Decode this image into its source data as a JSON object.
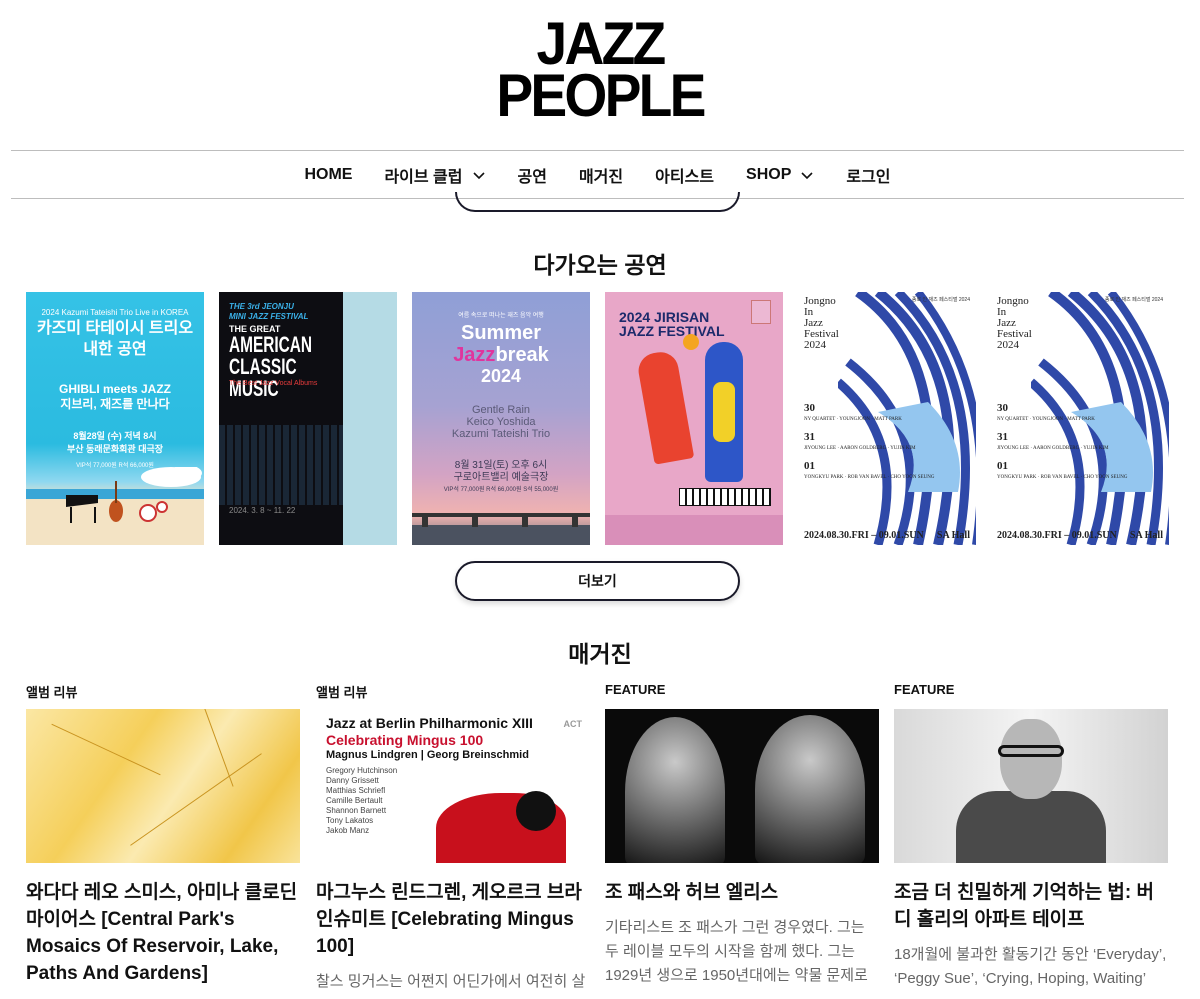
{
  "logo": {
    "line1": "JAZZ",
    "line2": "PEOPLE"
  },
  "nav": {
    "items": [
      {
        "label": "HOME",
        "has_dropdown": false
      },
      {
        "label": "라이브 클럽",
        "has_dropdown": true
      },
      {
        "label": "공연",
        "has_dropdown": false
      },
      {
        "label": "매거진",
        "has_dropdown": false
      },
      {
        "label": "아티스트",
        "has_dropdown": false
      },
      {
        "label": "SHOP",
        "has_dropdown": true
      },
      {
        "label": "로그인",
        "has_dropdown": false
      }
    ]
  },
  "upcoming": {
    "title": "다가오는 공연",
    "more_label": "더보기",
    "posters": [
      {
        "line1": "2024 Kazumi Tateishi Trio Live in KOREA",
        "line2": "카즈미 타테이시 트리오",
        "line3": "내한 공연",
        "line4": "GHIBLI meets JAZZ",
        "line5": "지브리, 재즈를 만나다",
        "line6": "8월28일 (수) 저녁 8시",
        "line7": "부산 동래문화회관 대극장",
        "line8": "VIP석 77,000원 R석 66,000원"
      },
      {
        "line1": "THE 3rd JEONJU",
        "line1b": "MINI JAZZ FESTIVAL",
        "line2": "THE GREAT",
        "line3": "AMERICAN",
        "line3b": "CLASSIC MUSIC",
        "line4": "The Best Jazz Vocal Albums",
        "line5": "2024. 3. 8 ~ 11. 22"
      },
      {
        "line0": "여름 속으로 떠나는 재즈 음악 여행",
        "line1": "Summer",
        "line2a": "Jazz",
        "line2b": "break",
        "line3": "2024",
        "line4": "Gentle Rain",
        "line5": "Keico Yoshida",
        "line6": "Kazumi Tateishi Trio",
        "line7": "8월 31일(토) 오후 6시",
        "line8": "구로아트밸리 예술극장",
        "line9": "VIP석 77,000원 R석 66,000원 S석 55,000원"
      },
      {
        "line1": "2024 JIRISAN",
        "line2": "JAZZ FESTIVAL"
      },
      {
        "line1": "Jongno",
        "line2": "In",
        "line3": "Jazz",
        "line4": "Festival",
        "line5": "2024",
        "top_right": "종로 인 재즈 페스티벌 2024",
        "d1_day": "30",
        "d1_sub": "NY QUARTET · YOUNGJOON · MATT PARK",
        "d2_day": "31",
        "d2_sub": "JIYOUNG LEE · AARON GOLDBERG · YUJIN KIM",
        "d3_day": "01",
        "d3_sub": "YONGKYU PARK · ROB VAN BAVEL · CHO YOON SEUNG",
        "footer_date": "2024.08.30.FRI – 09.01.SUN",
        "footer_hall": "SA Hall"
      },
      {
        "line1": "Jongno",
        "line2": "In",
        "line3": "Jazz",
        "line4": "Festival",
        "line5": "2024",
        "top_right": "종로 인 재즈 페스티벌 2024",
        "d1_day": "30",
        "d1_sub": "NY QUARTET · YOUNGJOON · MATT PARK",
        "d2_day": "31",
        "d2_sub": "JIYOUNG LEE · AARON GOLDBERG · YUJIN KIM",
        "d3_day": "01",
        "d3_sub": "YONGKYU PARK · ROB VAN BAVEL · CHO YOON SEUNG",
        "footer_date": "2024.08.30.FRI – 09.01.SUN",
        "footer_hall": "SA Hall"
      }
    ]
  },
  "magazine": {
    "title": "매거진",
    "cards": [
      {
        "category": "앨범 리뷰",
        "title": "와다다 레오 스미스, 아미나 클로딘 마이어스 [Central Park's Mosaics Of Reservoir, Lake, Paths And Gardens]",
        "excerpt": ""
      },
      {
        "category": "앨범 리뷰",
        "title": "마그누스 린드그렌, 게오르크 브라인슈미트 [Celebrating Mingus 100]",
        "excerpt": "찰스 밍거스는 어쩐지 어딘가에서 여전히 살",
        "thumb": {
          "line1": "Jazz at Berlin Philharmonic XIII",
          "line2": "Celebrating Mingus 100",
          "line3": "Magnus Lindgren | Georg Breinschmid",
          "names": "Gregory Hutchinson\nDanny Grissett\nMatthias Schriefl\nCamille Bertault\nShannon Barnett\nTony Lakatos\nJakob Manz",
          "label": "ACT"
        }
      },
      {
        "category": "FEATURE",
        "title": "조 패스와 허브 엘리스",
        "excerpt": "기타리스트 조 패스가 그런 경우였다. 그는 두 레이블 모두의 시작을 함께 했다. 그는 1929년 생으로 1950년대에는 약물 문제로"
      },
      {
        "category": "FEATURE",
        "title": "조금 더 친밀하게 기억하는 법: 버디 홀리의 아파트 테이프",
        "excerpt": "18개월에 불과한 활동기간 동안 ‘Everyday’, ‘Peggy Sue’, ‘Crying, Hoping, Waiting’"
      }
    ]
  }
}
